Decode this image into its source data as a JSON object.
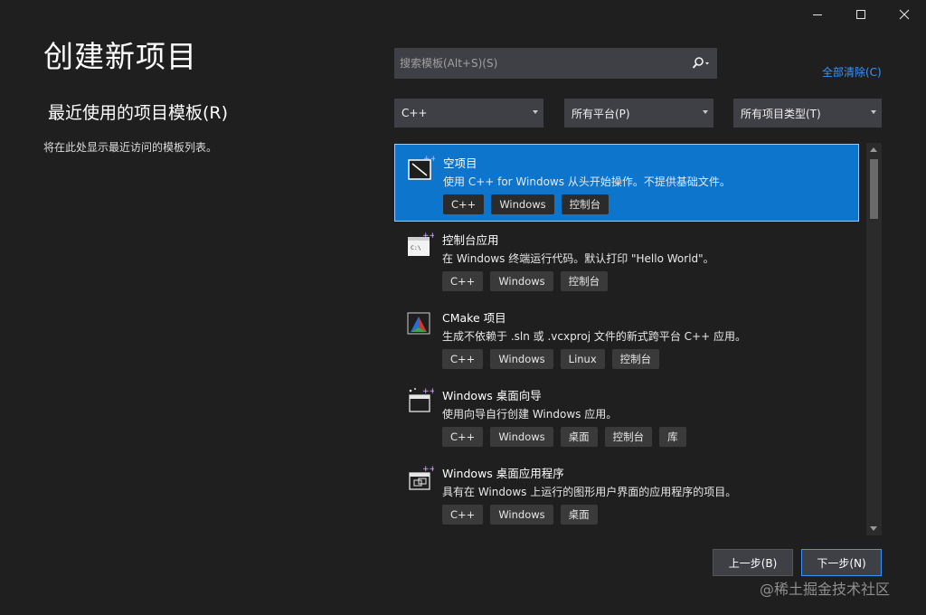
{
  "window": {
    "controls": [
      "minimize",
      "maximize",
      "close"
    ]
  },
  "page_title": "创建新项目",
  "recent": {
    "title": "最近使用的项目模板(R)",
    "empty_text": "将在此处显示最近访问的模板列表。"
  },
  "search": {
    "placeholder": "搜索模板(Alt+S)(S)",
    "value": ""
  },
  "clear_all": "全部清除(C)",
  "filters": {
    "language": "C++",
    "platform": "所有平台(P)",
    "project_type": "所有项目类型(T)"
  },
  "templates": [
    {
      "name": "空项目",
      "description": "使用 C++ for Windows 从头开始操作。不提供基础文件。",
      "tags": [
        "C++",
        "Windows",
        "控制台"
      ],
      "icon": "empty-project-icon",
      "selected": true
    },
    {
      "name": "控制台应用",
      "description": "在 Windows 终端运行代码。默认打印 \"Hello World\"。",
      "tags": [
        "C++",
        "Windows",
        "控制台"
      ],
      "icon": "console-app-icon",
      "selected": false
    },
    {
      "name": "CMake 项目",
      "description": "生成不依赖于 .sln 或 .vcxproj 文件的新式跨平台 C++ 应用。",
      "tags": [
        "C++",
        "Windows",
        "Linux",
        "控制台"
      ],
      "icon": "cmake-icon",
      "selected": false
    },
    {
      "name": "Windows 桌面向导",
      "description": "使用向导自行创建 Windows 应用。",
      "tags": [
        "C++",
        "Windows",
        "桌面",
        "控制台",
        "库"
      ],
      "icon": "desktop-wizard-icon",
      "selected": false
    },
    {
      "name": "Windows 桌面应用程序",
      "description": "具有在 Windows 上运行的图形用户界面的应用程序的项目。",
      "tags": [
        "C++",
        "Windows",
        "桌面"
      ],
      "icon": "desktop-app-icon",
      "selected": false
    }
  ],
  "buttons": {
    "back": "上一步(B)",
    "next": "下一步(N)"
  },
  "watermark": "@稀土掘金技术社区",
  "colors": {
    "background": "#1f1f1f",
    "selection": "#0e75cc",
    "accent": "#3794ff",
    "control": "#3f3f46"
  }
}
